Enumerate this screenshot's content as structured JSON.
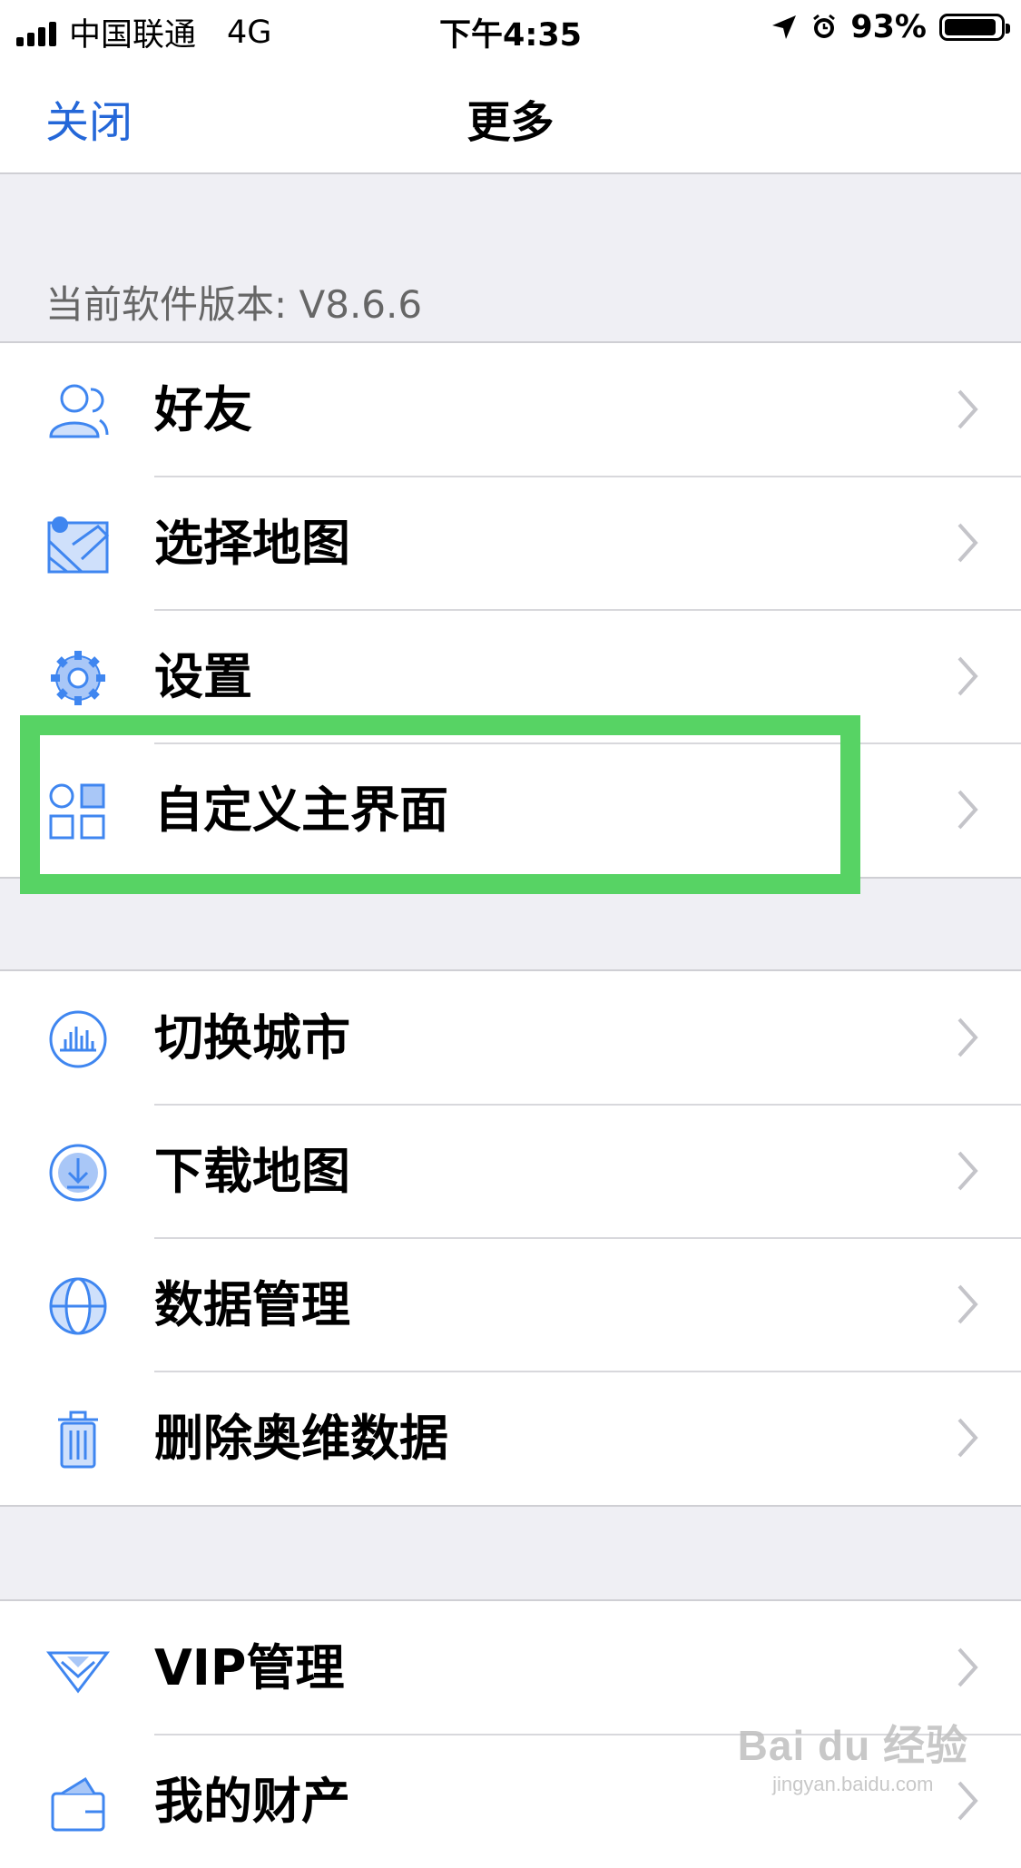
{
  "status_bar": {
    "carrier": "中国联通",
    "network": "4G",
    "time": "下午4:35",
    "battery": "93%",
    "battery_level": 0.93
  },
  "nav": {
    "close_label": "关闭",
    "title": "更多"
  },
  "version_text": "当前软件版本: V8.6.6",
  "groups": [
    {
      "items": [
        {
          "label": "好友",
          "icon": "friends-icon"
        },
        {
          "label": "选择地图",
          "icon": "map-icon"
        },
        {
          "label": "设置",
          "icon": "gear-icon"
        },
        {
          "label": "自定义主界面",
          "icon": "grid-icon",
          "highlighted": true
        }
      ]
    },
    {
      "items": [
        {
          "label": "切换城市",
          "icon": "city-icon"
        },
        {
          "label": "下载地图",
          "icon": "download-icon"
        },
        {
          "label": "数据管理",
          "icon": "globe-icon"
        },
        {
          "label": "删除奥维数据",
          "icon": "trash-icon"
        }
      ]
    },
    {
      "items": [
        {
          "label": "VIP管理",
          "icon": "vip-icon"
        },
        {
          "label": "我的财产",
          "icon": "wallet-icon"
        }
      ]
    }
  ],
  "colors": {
    "accent": "#2467d8",
    "icon_blue": "#3f86f0",
    "highlight": "#57d364",
    "background": "#efeff4"
  },
  "watermark": {
    "main": "Bai du 经验",
    "sub": "jingyan.baidu.com"
  }
}
